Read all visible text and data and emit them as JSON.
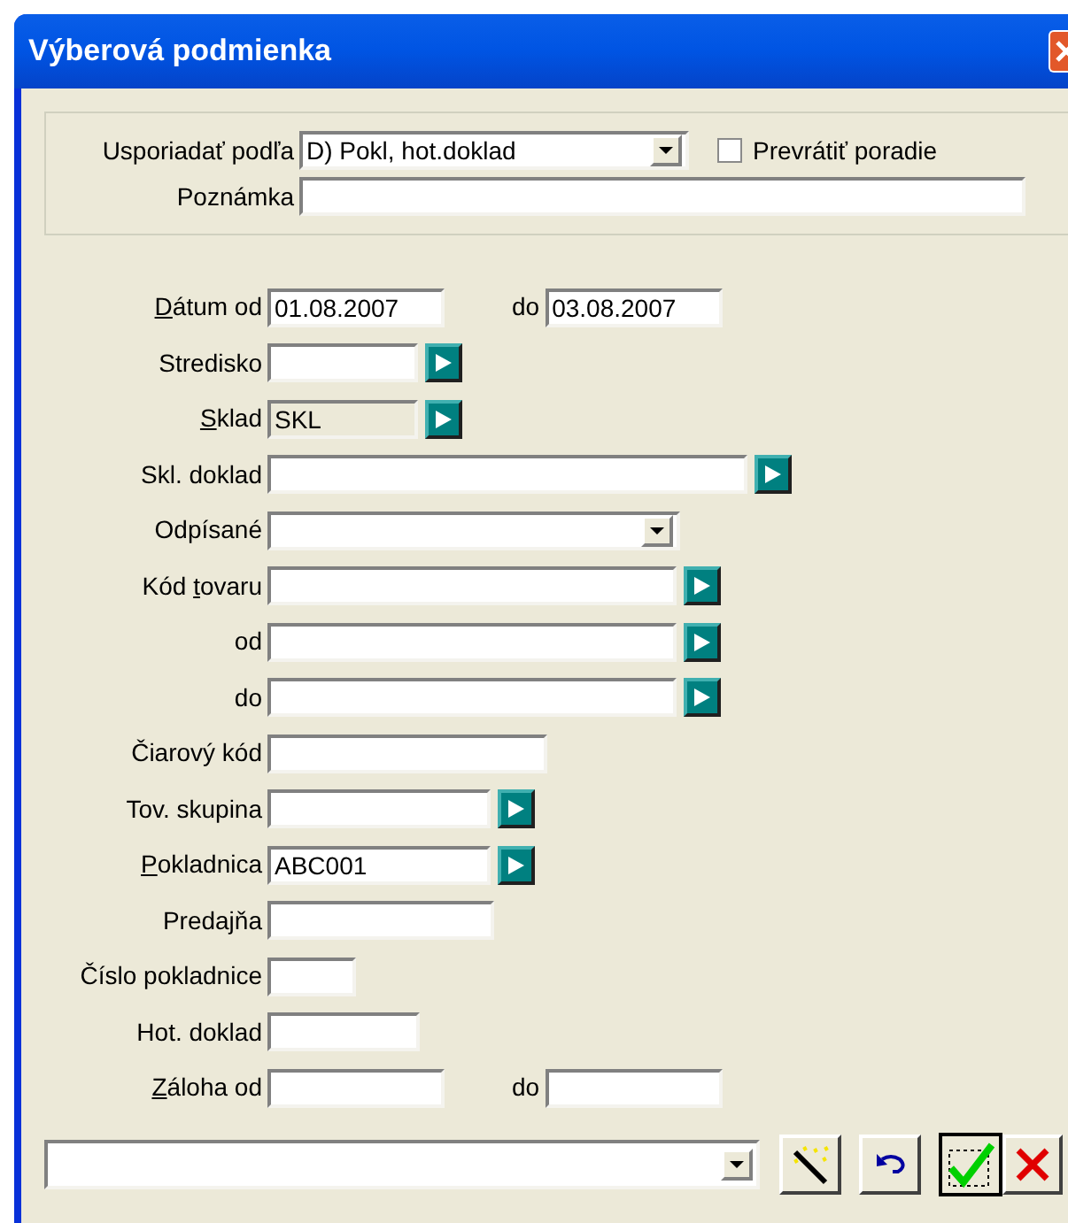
{
  "window": {
    "title": "Výberová podmienka"
  },
  "sort": {
    "label": "Usporiadať podľa",
    "value": "D) Pokl, hot.doklad",
    "reverse_label": "Prevrátiť poradie",
    "reverse_checked": false,
    "note_label": "Poznámka"
  },
  "rows": [
    {
      "kind": "text",
      "label_parts": [
        {
          "text": "D",
          "underline": true
        },
        {
          "text": "átum od",
          "underline": false
        }
      ],
      "value": "01.08.2007",
      "lookup": false,
      "disabled": false,
      "to_label": "do",
      "to_value": "03.08.2007"
    },
    {
      "kind": "text",
      "label_parts": [
        {
          "text": "Stredisko",
          "underline": false
        }
      ],
      "lookup": true,
      "disabled": false
    },
    {
      "kind": "text",
      "label_parts": [
        {
          "text": "S",
          "underline": true
        },
        {
          "text": "klad",
          "underline": false
        }
      ],
      "value": "SKL",
      "lookup": true,
      "disabled": true
    },
    {
      "kind": "text",
      "label_parts": [
        {
          "text": "Skl. doklad",
          "underline": false
        }
      ],
      "lookup": true,
      "disabled": false
    },
    {
      "kind": "combo",
      "label_parts": [
        {
          "text": "Odpísané",
          "underline": false
        }
      ],
      "lookup": false,
      "disabled": false
    },
    {
      "kind": "text",
      "label_parts": [
        {
          "text": "Kód ",
          "underline": false
        },
        {
          "text": "t",
          "underline": true
        },
        {
          "text": "ovaru",
          "underline": false
        }
      ],
      "lookup": true,
      "disabled": false
    },
    {
      "kind": "text",
      "label_parts": [
        {
          "text": "od",
          "underline": false
        }
      ],
      "lookup": true,
      "disabled": false
    },
    {
      "kind": "text",
      "label_parts": [
        {
          "text": "do",
          "underline": false
        }
      ],
      "lookup": true,
      "disabled": false
    },
    {
      "kind": "text",
      "label_parts": [
        {
          "text": "Čiarový kód",
          "underline": false
        }
      ],
      "lookup": false,
      "disabled": false
    },
    {
      "kind": "text",
      "label_parts": [
        {
          "text": "Tov. skupina",
          "underline": false
        }
      ],
      "lookup": true,
      "disabled": false
    },
    {
      "kind": "text",
      "label_parts": [
        {
          "text": "P",
          "underline": true
        },
        {
          "text": "okladnica",
          "underline": false
        }
      ],
      "value": "ABC001",
      "lookup": true,
      "disabled": false
    },
    {
      "kind": "text",
      "label_parts": [
        {
          "text": "Predajňa",
          "underline": false
        }
      ],
      "lookup": false,
      "disabled": false
    },
    {
      "kind": "text",
      "label_parts": [
        {
          "text": "Číslo pokladnice",
          "underline": false
        }
      ],
      "lookup": false,
      "disabled": false
    },
    {
      "kind": "text",
      "label_parts": [
        {
          "text": "Hot. doklad",
          "underline": false
        }
      ],
      "lookup": false,
      "disabled": false
    },
    {
      "kind": "text",
      "label_parts": [
        {
          "text": "Z",
          "underline": true
        },
        {
          "text": "áloha od",
          "underline": false
        }
      ],
      "lookup": false,
      "disabled": false,
      "to_label": "do"
    }
  ]
}
